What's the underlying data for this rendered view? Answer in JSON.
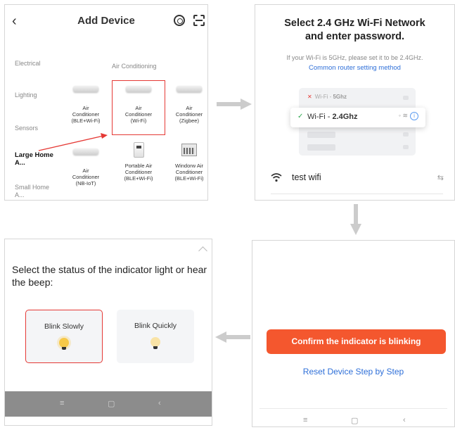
{
  "panel1": {
    "back_icon": "‹",
    "title": "Add Device",
    "categories": [
      "Electrical",
      "Lighting",
      "Sensors",
      "Large Home A...",
      "Small Home A..."
    ],
    "active_category": "Large Home A...",
    "subheading": "Air Conditioning",
    "devices": [
      {
        "label": "Air\nConditioner\n(BLE+Wi-Fi)"
      },
      {
        "label": "Air\nConditioner\n(Wi-Fi)"
      },
      {
        "label": "Air\nConditioner\n(Zigbee)"
      },
      {
        "label": "Air\nConditioner\n(NB-IoT)"
      },
      {
        "label": "Portable Air\nConditioner\n(BLE+Wi-Fi)"
      },
      {
        "label": "Windorw Air\nConditioner\n(BLE+Wi-Fi)"
      }
    ],
    "selected_device": "Air Conditioner (Wi-Fi)"
  },
  "panel2": {
    "title": "Select 2.4 GHz Wi-Fi Network\nand enter password.",
    "note": "If your Wi-Fi is 5GHz, please set it to be 2.4GHz.",
    "link": "Common router setting method",
    "network_5g_prefix": "Wi-Fi - ",
    "network_5g_band": "5Ghz",
    "network_24_prefix": "Wi-Fi - ",
    "network_24_band": "2.4Ghz",
    "ssid": "test wifi"
  },
  "panel3": {
    "question": "Select the status of the indicator light or hear the beep:",
    "options": [
      {
        "label": "Blink Slowly"
      },
      {
        "label": "Blink Quickly"
      }
    ],
    "selected_option": "Blink Slowly",
    "nav": {
      "menu": "≡",
      "home": "▢",
      "back": "‹"
    }
  },
  "panel4": {
    "confirm_button": "Confirm the indicator is blinking",
    "reset_link": "Reset Device Step by Step",
    "nav": {
      "menu": "≡",
      "home": "▢",
      "back": "‹"
    }
  },
  "colors": {
    "accent_orange": "#f4572e",
    "link_blue": "#2e6fd8",
    "highlight_red": "#e53935",
    "check_green": "#2fa84f",
    "arrow_gray": "#cccccc"
  }
}
